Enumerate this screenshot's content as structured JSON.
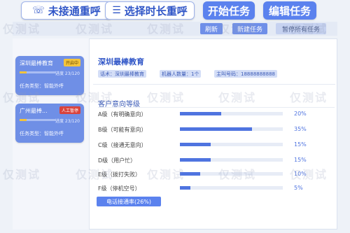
{
  "top_buttons": {
    "missed_redial": "未接通重呼",
    "select_redial": "选择时长重呼",
    "start_task": "开始任务",
    "edit_task": "编辑任务"
  },
  "toolbar": {
    "refresh": "刷新",
    "new_task": "新建任务",
    "pause_all": "暂停所有任务"
  },
  "task_cards": [
    {
      "name": "深圳最棒教育",
      "status": "开启中",
      "progress_text": "进度 23/120",
      "progress": 0.19,
      "type": "任务类型：智能外呼"
    },
    {
      "name": "广州最棒...",
      "status": "人工暂停",
      "progress_text": "进度 23/120",
      "progress": 0.19,
      "type": "任务类型：智能外呼"
    }
  ],
  "detail": {
    "title": "深圳最棒教育",
    "chips": [
      "话术：深圳最棒教育",
      "机器人数量：1个",
      "主叫号码：18888888888"
    ],
    "section_title": "客户意向等级",
    "levels": [
      {
        "label": "A级（有明确意向）",
        "percent_text": "20%",
        "value": 20
      },
      {
        "label": "B级（可能有意向）",
        "percent_text": "35%",
        "value": 35
      },
      {
        "label": "C级（接通无意向）",
        "percent_text": "15%",
        "value": 15
      },
      {
        "label": "D级（用户忙）",
        "percent_text": "15%",
        "value": 15
      },
      {
        "label": "E级（拨打失败）",
        "percent_text": "10%",
        "value": 10
      },
      {
        "label": "F级（停机空号）",
        "percent_text": "5%",
        "value": 5
      }
    ],
    "connect_rate": "电话接通率(26%)"
  },
  "watermark": "仅测试",
  "colors": {
    "primary": "#5b82ee",
    "accent_text": "#2f55c7",
    "bar_fill": "#4f74e0",
    "status_running": "#f3c43c",
    "status_paused": "#d9433c"
  }
}
